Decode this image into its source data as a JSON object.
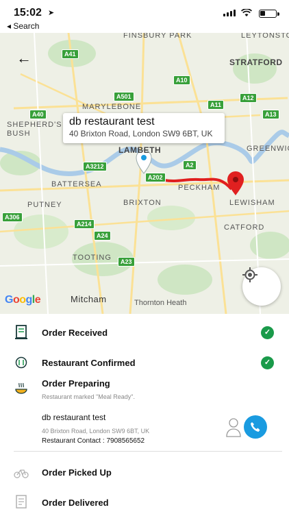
{
  "status": {
    "time": "15:02",
    "back_label": "◂ Search"
  },
  "map": {
    "tooltip_title": "db restaurant test",
    "tooltip_address": "40 Brixton Road, London SW9 6BT, UK",
    "place_labels": [
      "FINSBURY PARK",
      "LEYTONSTONE",
      "STRATFORD",
      "MARYLEBONE",
      "SHEPHERD'S BUSH",
      "LAMBETH",
      "GREENWICH",
      "BATTERSEA",
      "PECKHAM",
      "BRIXTON",
      "LEWISHAM",
      "PUTNEY",
      "CATFORD",
      "TOOTING",
      "Mitcham",
      "Thornton Heath"
    ],
    "road_shields": [
      "A41",
      "A10",
      "A501",
      "A12",
      "A40",
      "A11",
      "A13",
      "A3212",
      "A2",
      "A202",
      "A306",
      "A214",
      "A24",
      "A23"
    ],
    "attribution": "Google"
  },
  "panel": {
    "step_received": "Order Received",
    "step_confirmed": "Restaurant Confirmed",
    "step_preparing": "Order Preparing",
    "preparing_sub": "Restaurant marked \"Meal Ready\".",
    "restaurant_name": "db restaurant test",
    "restaurant_address": "40 Brixton Road, London SW9 6BT, UK",
    "restaurant_contact": "Restaurant Contact : 7908565652",
    "step_picked": "Order Picked Up",
    "step_delivered": "Order Delivered"
  },
  "colors": {
    "route": "#e01e1e",
    "check": "#1a9a4a",
    "call_button": "#1a9be0",
    "road_shield": "#38a03a"
  },
  "icons": [
    "back-arrow-icon",
    "location-arrow-icon",
    "signal-icon",
    "wifi-icon",
    "battery-icon",
    "restaurant-pin-icon",
    "destination-pin-icon",
    "locate-icon",
    "receipt-icon",
    "restaurant-icon",
    "cooking-icon",
    "check-icon",
    "person-icon",
    "phone-icon",
    "bike-icon",
    "delivered-icon"
  ]
}
